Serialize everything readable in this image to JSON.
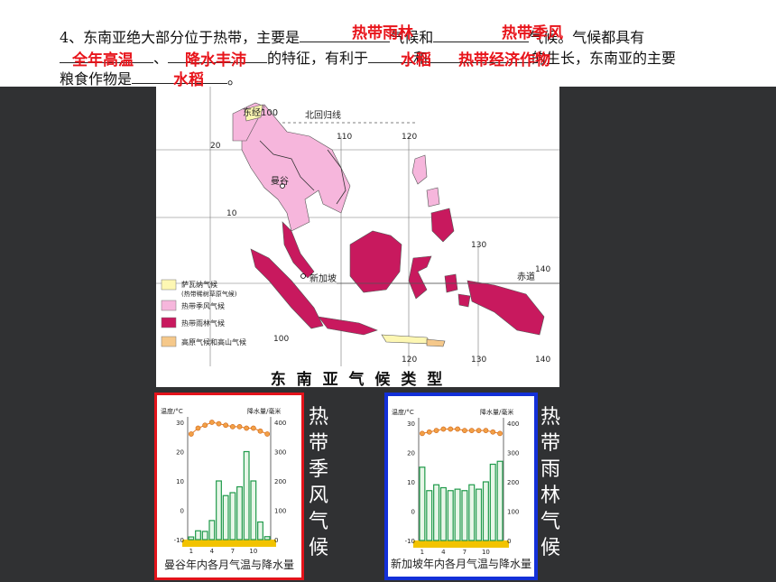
{
  "question": {
    "line1_a": "4、东南亚绝大部分位于热带，主要是",
    "line1_b": "气候和",
    "line1_c": "气候。气候都具有",
    "line2_a": "、",
    "line2_b": "的特征，有利于",
    "line2_c": "和",
    "line2_d": "的生长，东南亚的主要",
    "line3_a": "粮食作物是",
    "line3_b": "。"
  },
  "answers": {
    "a1": "热带雨林",
    "a2": "热带季风",
    "a3": "全年高温",
    "a4": "降水丰沛",
    "a5": "水稻",
    "a6": "热带经济作物",
    "a7": "水稻"
  },
  "map": {
    "caption": "东 南 亚 气 候 类 型",
    "labels": {
      "meridian100": "东经100",
      "tropic": "北回归线",
      "bangkok": "曼谷",
      "singapore": "新加坡",
      "equator": "赤道"
    },
    "ticks": {
      "lon110": "110",
      "lon120": "120",
      "lon130": "130",
      "lon140a": "140",
      "lon140b": "140",
      "lon100": "100",
      "lon120b": "120",
      "lon130b": "130",
      "lat20": "20",
      "lat10": "10"
    },
    "legend": [
      {
        "label": "萨瓦纳气候",
        "sub": "(热带稀树草原气候)",
        "color": "#fdf7b3"
      },
      {
        "label": "热带季风气候",
        "sub": "",
        "color": "#f6b6dc"
      },
      {
        "label": "热带雨林气候",
        "sub": "",
        "color": "#c8195e"
      },
      {
        "label": "高原气候和高山气候",
        "sub": "",
        "color": "#f5c88a"
      }
    ],
    "colors": {
      "monsoon": "#f6b6dc",
      "rainforest": "#c8195e",
      "savanna": "#fdf7b3",
      "highland": "#f5c88a"
    }
  },
  "charts": [
    {
      "id": "bangkok",
      "border": "#e3131b",
      "title_vertical": [
        "热",
        "带",
        "季",
        "风",
        "气",
        "候"
      ],
      "caption": "曼谷年内各月气温与降水量",
      "temp_label": "温度/°C",
      "precip_label": "降水量/毫米",
      "left_ticks": [
        "30",
        "20",
        "10",
        "0",
        "-10"
      ],
      "right_ticks": [
        "400",
        "300",
        "200",
        "100",
        "0"
      ],
      "month_ticks": [
        "1",
        "4",
        "7",
        "10"
      ],
      "chart_data": {
        "type": "bar",
        "categories": [
          "1",
          "2",
          "3",
          "4",
          "5",
          "6",
          "7",
          "8",
          "9",
          "10",
          "11",
          "12"
        ],
        "series": [
          {
            "values": [
              9,
              30,
              28,
              65,
              200,
              150,
              160,
              180,
              300,
              200,
              60,
              10
            ]
          },
          {
            "values": [
              26,
              28,
              29,
              30,
              29.5,
              29,
              28.5,
              28.5,
              28,
              28,
              27,
              26
            ]
          }
        ],
        "ylim_temp": [
          -10,
          30
        ],
        "ylim_precip": [
          0,
          400
        ]
      }
    },
    {
      "id": "singapore",
      "border": "#1330d8",
      "title_vertical": [
        "热",
        "带",
        "雨",
        "林",
        "气",
        "候"
      ],
      "caption": "新加坡年内各月气温与降水量",
      "temp_label": "温度/°C",
      "precip_label": "降水量/毫米",
      "left_ticks": [
        "30",
        "20",
        "10",
        "0",
        "-10"
      ],
      "right_ticks": [
        "400",
        "300",
        "200",
        "100",
        "0"
      ],
      "month_ticks": [
        "1",
        "4",
        "7",
        "10"
      ],
      "chart_data": {
        "type": "bar",
        "categories": [
          "1",
          "2",
          "3",
          "4",
          "5",
          "6",
          "7",
          "8",
          "9",
          "10",
          "11",
          "12"
        ],
        "series": [
          {
            "values": [
              250,
              170,
              190,
              180,
              170,
              175,
              170,
              190,
              175,
              200,
              260,
              270
            ]
          },
          {
            "values": [
              26.5,
              27,
              27.5,
              28,
              28,
              28,
              27.5,
              27.5,
              27.5,
              27.5,
              27,
              26.5
            ]
          }
        ],
        "ylim_temp": [
          -10,
          30
        ],
        "ylim_precip": [
          0,
          400
        ]
      }
    }
  ]
}
